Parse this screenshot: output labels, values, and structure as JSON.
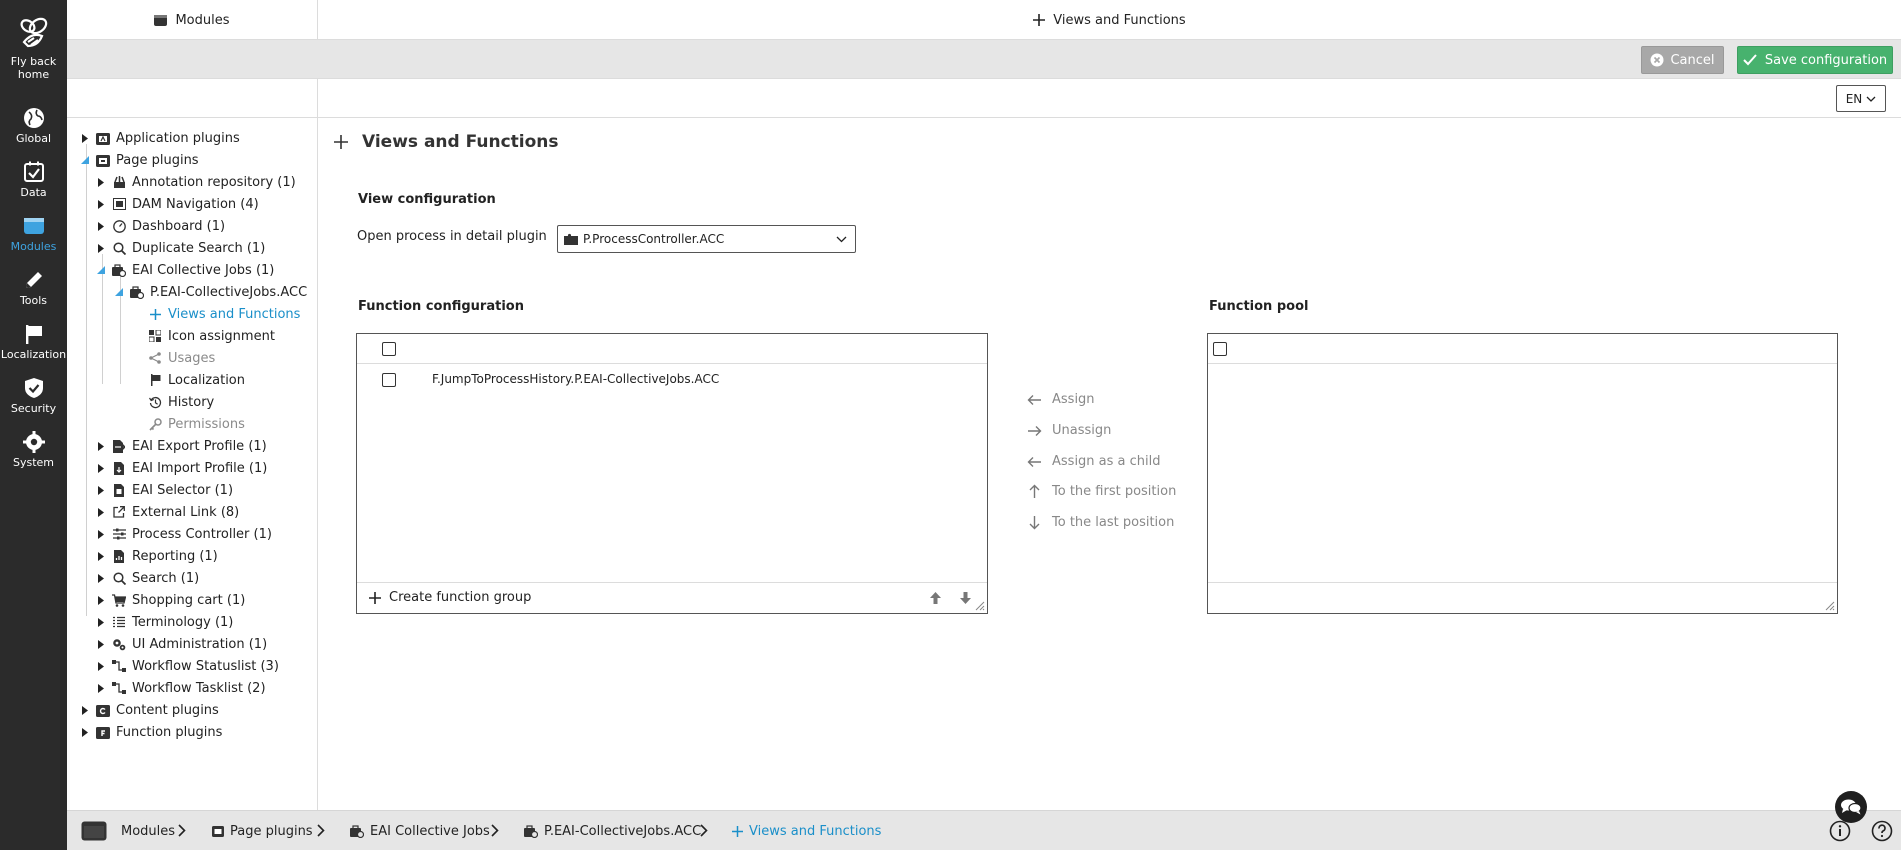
{
  "rail": {
    "items": [
      {
        "label": "Fly back home"
      },
      {
        "label": "Global"
      },
      {
        "label": "Data"
      },
      {
        "label": "Modules"
      },
      {
        "label": "Tools"
      },
      {
        "label": "Localization"
      },
      {
        "label": "Security"
      },
      {
        "label": "System"
      }
    ],
    "active_color": "#3ea3e0"
  },
  "topbar": {
    "left_title": "Modules",
    "center_title": "Views and Functions"
  },
  "actions": {
    "cancel_label": "Cancel",
    "save_label": "Save configuration",
    "save_color": "#47b26e"
  },
  "language": {
    "selected": "EN"
  },
  "tree": {
    "items": [
      {
        "label": "Application plugins"
      },
      {
        "label": "Page plugins"
      },
      {
        "label": "Annotation repository (1)"
      },
      {
        "label": "DAM Navigation (4)"
      },
      {
        "label": "Dashboard (1)"
      },
      {
        "label": "Duplicate Search (1)"
      },
      {
        "label": "EAI Collective Jobs (1)"
      },
      {
        "label": "P.EAI-CollectiveJobs.ACC"
      },
      {
        "label": "Views and Functions"
      },
      {
        "label": "Icon assignment"
      },
      {
        "label": "Usages"
      },
      {
        "label": "Localization"
      },
      {
        "label": "History"
      },
      {
        "label": "Permissions"
      },
      {
        "label": "EAI Export Profile (1)"
      },
      {
        "label": "EAI Import Profile (1)"
      },
      {
        "label": "EAI Selector (1)"
      },
      {
        "label": "External Link (8)"
      },
      {
        "label": "Process Controller (1)"
      },
      {
        "label": "Reporting (1)"
      },
      {
        "label": "Search (1)"
      },
      {
        "label": "Shopping cart (1)"
      },
      {
        "label": "Terminology (1)"
      },
      {
        "label": "UI Administration (1)"
      },
      {
        "label": "Workflow Statuslist (3)"
      },
      {
        "label": "Workflow Tasklist (2)"
      },
      {
        "label": "Content plugins"
      },
      {
        "label": "Function plugins"
      }
    ]
  },
  "main": {
    "title": "Views and Functions",
    "view_config_heading": "View configuration",
    "open_process_label": "Open process in detail plugin",
    "open_process_value": "P.ProcessController.ACC",
    "function_config_heading": "Function configuration",
    "function_pool_heading": "Function pool",
    "function_config_rows": [
      {
        "label": "F.JumpToProcessHistory.P.EAI-CollectiveJobs.ACC"
      }
    ],
    "create_group_label": "Create function group",
    "move_actions": [
      {
        "label": "Assign"
      },
      {
        "label": "Unassign"
      },
      {
        "label": "Assign as a child"
      },
      {
        "label": "To the first position"
      },
      {
        "label": "To the last position"
      }
    ]
  },
  "breadcrumb": [
    {
      "label": "Modules"
    },
    {
      "label": "Page plugins"
    },
    {
      "label": "EAI Collective Jobs"
    },
    {
      "label": "P.EAI-CollectiveJobs.ACC"
    },
    {
      "label": "Views and Functions"
    }
  ],
  "colors": {
    "link": "#1a8fc9",
    "disabled": "#8a8a8a"
  }
}
